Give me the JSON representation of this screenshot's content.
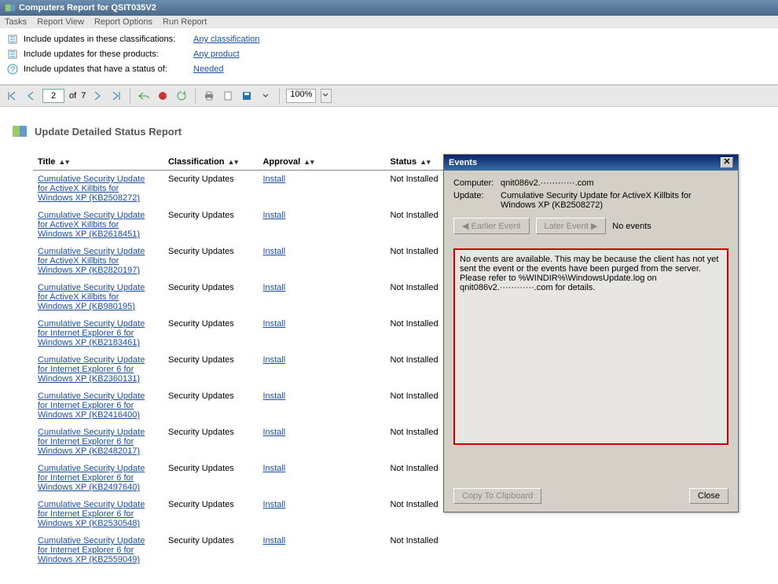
{
  "window": {
    "title": "Computers Report for QSIT035V2"
  },
  "menu": {
    "tasks": "Tasks",
    "reportView": "Report View",
    "reportOptions": "Report Options",
    "runReport": "Run Report"
  },
  "filters": {
    "row1label": "Include updates in these classifications:",
    "row1link": "Any classification",
    "row2label": "Include updates for these products:",
    "row2link": "Any product",
    "row3label": "Include updates that have a status of:",
    "row3link": "Needed"
  },
  "nav": {
    "page": "2",
    "ofLabel": "of",
    "totalPages": "7",
    "zoom": "100%"
  },
  "report": {
    "heading": "Update Detailed Status Report",
    "cols": {
      "title": "Title",
      "class": "Classification",
      "approval": "Approval",
      "status": "Status"
    },
    "rows": [
      {
        "title": "Cumulative Security Update for ActiveX Killbits for Windows XP (KB2508272)",
        "class": "Security Updates",
        "approval": "Install",
        "status": "Not Installed"
      },
      {
        "title": "Cumulative Security Update for ActiveX Killbits for Windows XP (KB2618451)",
        "class": "Security Updates",
        "approval": "Install",
        "status": "Not Installed"
      },
      {
        "title": "Cumulative Security Update for ActiveX Killbits for Windows XP (KB2820197)",
        "class": "Security Updates",
        "approval": "Install",
        "status": "Not Installed"
      },
      {
        "title": "Cumulative Security Update for ActiveX Killbits for Windows XP (KB980195)",
        "class": "Security Updates",
        "approval": "Install",
        "status": "Not Installed"
      },
      {
        "title": "Cumulative Security Update for Internet Explorer 6 for Windows XP (KB2183461)",
        "class": "Security Updates",
        "approval": "Install",
        "status": "Not Installed"
      },
      {
        "title": "Cumulative Security Update for Internet Explorer 6 for Windows XP (KB2360131)",
        "class": "Security Updates",
        "approval": "Install",
        "status": "Not Installed"
      },
      {
        "title": "Cumulative Security Update for Internet Explorer 6 for Windows XP (KB2416400)",
        "class": "Security Updates",
        "approval": "Install",
        "status": "Not Installed"
      },
      {
        "title": "Cumulative Security Update for Internet Explorer 6 for Windows XP (KB2482017)",
        "class": "Security Updates",
        "approval": "Install",
        "status": "Not Installed"
      },
      {
        "title": "Cumulative Security Update for Internet Explorer 6 for Windows XP (KB2497640)",
        "class": "Security Updates",
        "approval": "Install",
        "status": "Not Installed"
      },
      {
        "title": "Cumulative Security Update for Internet Explorer 6 for Windows XP (KB2530548)",
        "class": "Security Updates",
        "approval": "Install",
        "status": "Not Installed"
      },
      {
        "title": "Cumulative Security Update for Internet Explorer 6 for Windows XP (KB2559049)",
        "class": "Security Updates",
        "approval": "Install",
        "status": "Not Installed"
      }
    ]
  },
  "dialog": {
    "title": "Events",
    "computerLabel": "Computer:",
    "computerValue": "qnit086v2.············.com",
    "updateLabel": "Update:",
    "updateValue": "Cumulative Security Update for ActiveX Killbits for Windows XP (KB2508272)",
    "earlier": "Earlier Event",
    "later": "Later Event",
    "noevents": "No events",
    "message": "No events are available. This may be because the client has not yet sent the event or the events have been purged from the server. Please refer to %WINDIR%\\WindowsUpdate.log on qnit086v2.············.com for details.",
    "copy": "Copy To Clipboard",
    "close": "Close"
  }
}
